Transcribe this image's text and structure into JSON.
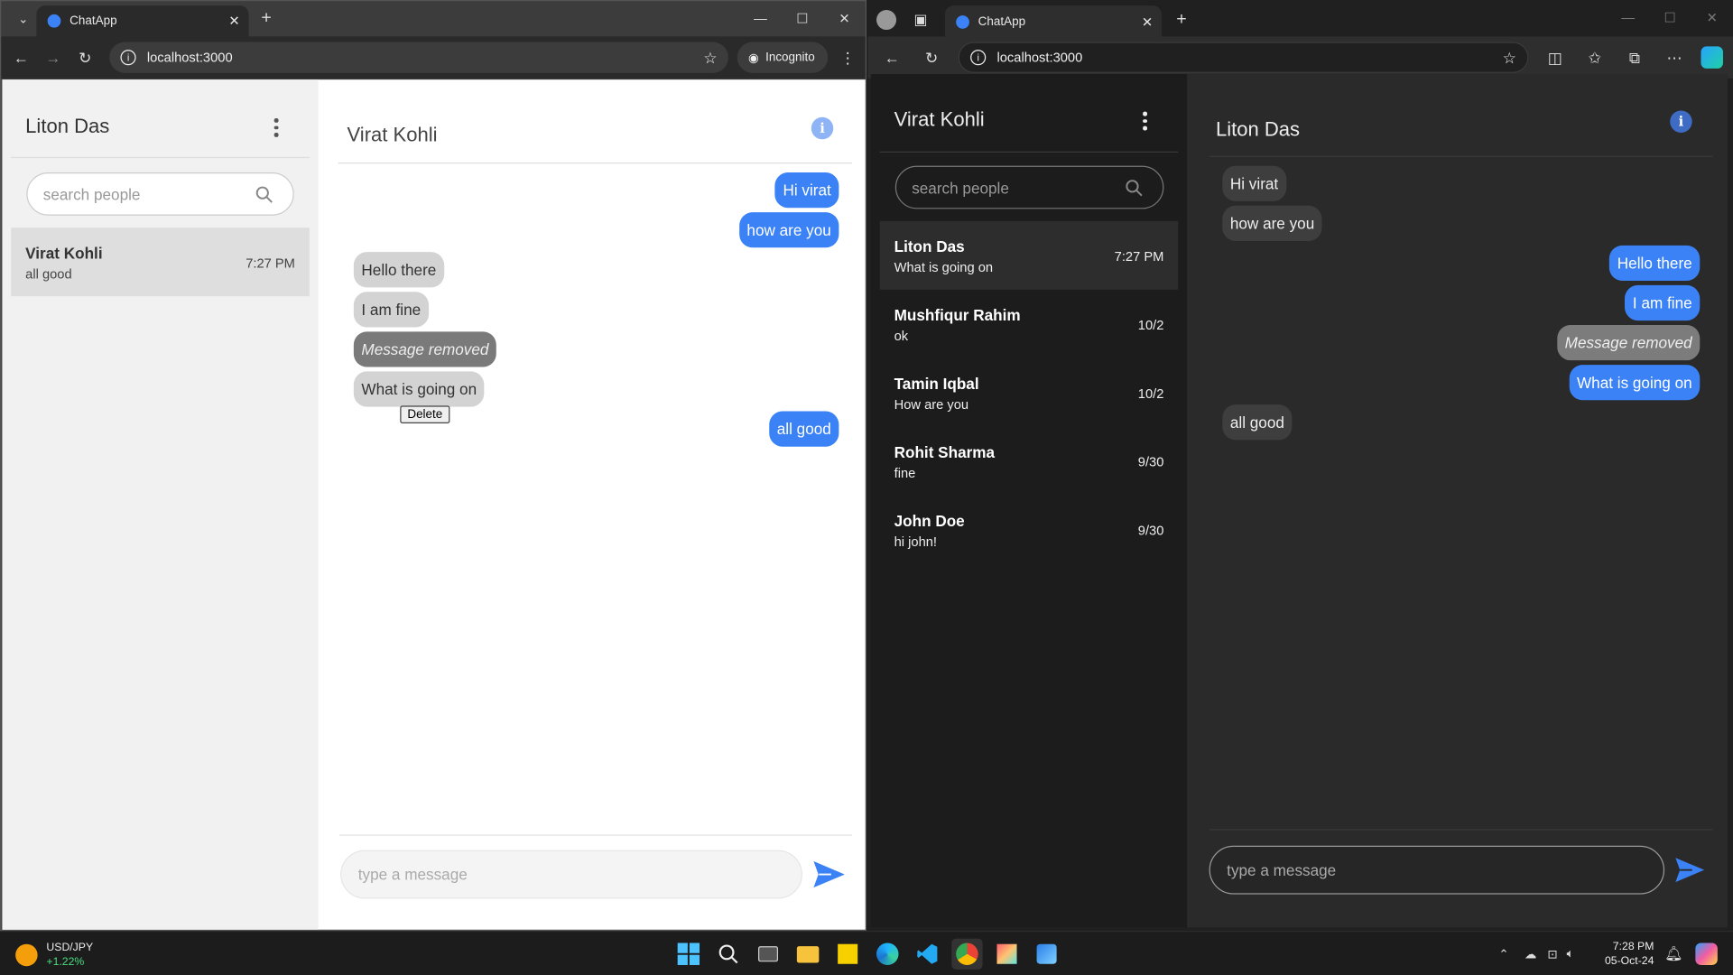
{
  "colors": {
    "accent": "#3b82f6",
    "left_sidebar_bg": "#f1f1f1",
    "right_sidebar_bg": "#1c1c1c",
    "right_chat_bg": "#2a2a2a"
  },
  "left_window": {
    "tab_title": "ChatApp",
    "url": "localhost:3000",
    "incognito_label": "Incognito",
    "sidebar": {
      "user_name": "Liton Das",
      "search_placeholder": "search people",
      "conversations": [
        {
          "name": "Virat Kohli",
          "last_message": "all good",
          "time": "7:27 PM"
        }
      ]
    },
    "chat": {
      "contact_name": "Virat Kohli",
      "messages": [
        {
          "text": "Hi virat",
          "from": "me"
        },
        {
          "text": "how are you",
          "from": "me"
        },
        {
          "text": "Hello there",
          "from": "them"
        },
        {
          "text": "I am fine",
          "from": "them"
        },
        {
          "text": "Message removed",
          "from": "them",
          "removed": true
        },
        {
          "text": "What is going on",
          "from": "them"
        },
        {
          "text": "all good",
          "from": "me"
        }
      ],
      "delete_label": "Delete",
      "input_placeholder": "type a message"
    }
  },
  "right_window": {
    "tab_title": "ChatApp",
    "url": "localhost:3000",
    "sidebar": {
      "user_name": "Virat Kohli",
      "search_placeholder": "search people",
      "conversations": [
        {
          "name": "Liton Das",
          "last_message": "What is going on",
          "time": "7:27 PM"
        },
        {
          "name": "Mushfiqur Rahim",
          "last_message": "ok",
          "time": "10/2"
        },
        {
          "name": "Tamin Iqbal",
          "last_message": "How are you",
          "time": "10/2"
        },
        {
          "name": "Rohit Sharma",
          "last_message": "fine",
          "time": "9/30"
        },
        {
          "name": "John Doe",
          "last_message": "hi john!",
          "time": "9/30"
        }
      ]
    },
    "chat": {
      "contact_name": "Liton Das",
      "messages": [
        {
          "text": "Hi virat",
          "from": "them"
        },
        {
          "text": "how are you",
          "from": "them"
        },
        {
          "text": "Hello there",
          "from": "me"
        },
        {
          "text": "I am fine",
          "from": "me"
        },
        {
          "text": "Message removed",
          "from": "me",
          "removed": true
        },
        {
          "text": "What is going on",
          "from": "me"
        },
        {
          "text": "all good",
          "from": "them"
        }
      ],
      "input_placeholder": "type a message"
    }
  },
  "taskbar": {
    "widget_title": "USD/JPY",
    "widget_change": "+1.22%",
    "apps": [
      "windows-start-icon",
      "search-icon",
      "task-view-icon",
      "file-explorer-icon",
      "sticky-notes-icon",
      "edge-icon",
      "vscode-icon",
      "chrome-icon",
      "snipping-tool-icon",
      "paint-icon"
    ],
    "time": "7:28 PM",
    "date": "05-Oct-24"
  }
}
